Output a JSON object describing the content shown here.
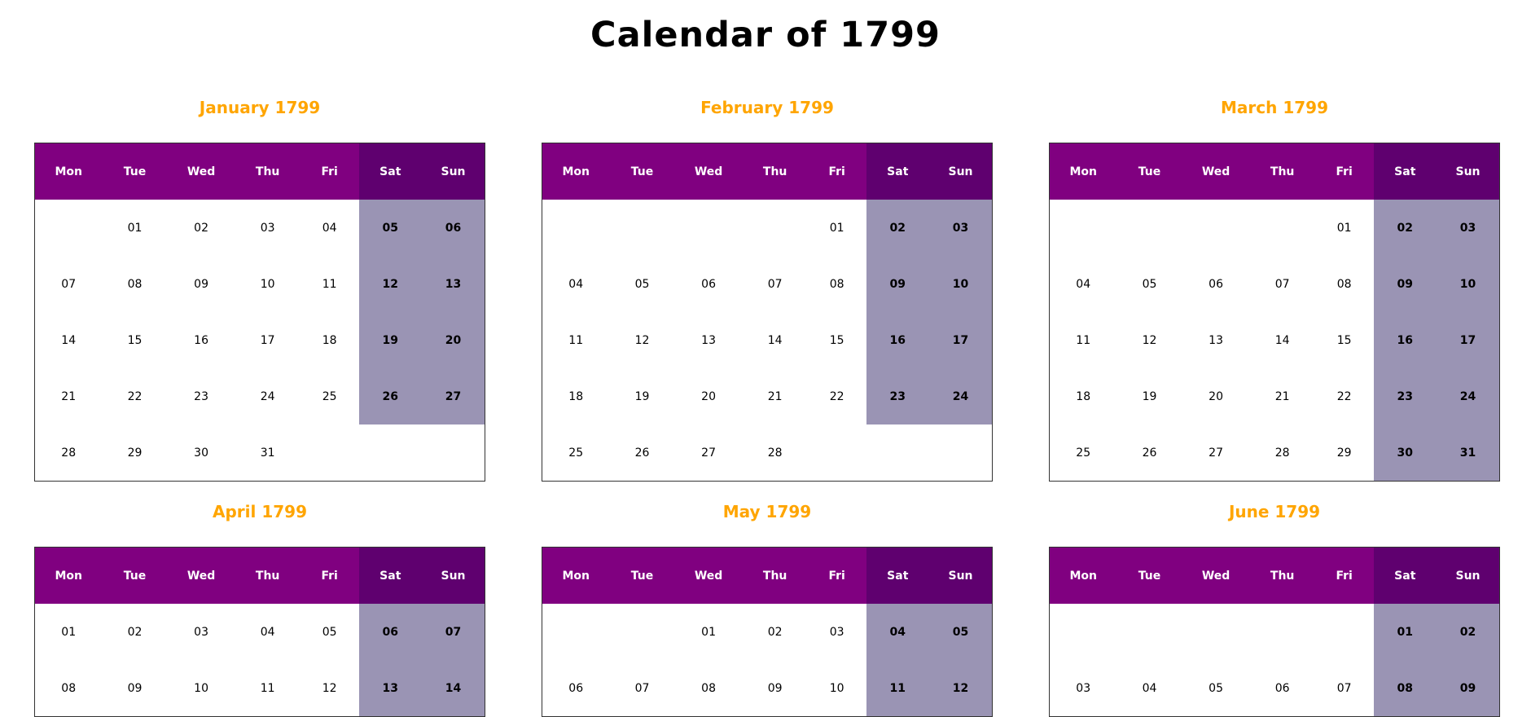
{
  "title": "Calendar of 1799",
  "colors": {
    "month_title": "#ffa500",
    "header_weekday": "#800080",
    "header_weekend": "#5f006f",
    "weekend_cell": "#9a94b4"
  },
  "weekdays": [
    "Mon",
    "Tue",
    "Wed",
    "Thu",
    "Fri",
    "Sat",
    "Sun"
  ],
  "months": [
    {
      "title": "January 1799",
      "weeks": [
        [
          "",
          "01",
          "02",
          "03",
          "04",
          "05",
          "06"
        ],
        [
          "07",
          "08",
          "09",
          "10",
          "11",
          "12",
          "13"
        ],
        [
          "14",
          "15",
          "16",
          "17",
          "18",
          "19",
          "20"
        ],
        [
          "21",
          "22",
          "23",
          "24",
          "25",
          "26",
          "27"
        ],
        [
          "28",
          "29",
          "30",
          "31",
          "",
          "",
          ""
        ]
      ]
    },
    {
      "title": "February 1799",
      "weeks": [
        [
          "",
          "",
          "",
          "",
          "01",
          "02",
          "03"
        ],
        [
          "04",
          "05",
          "06",
          "07",
          "08",
          "09",
          "10"
        ],
        [
          "11",
          "12",
          "13",
          "14",
          "15",
          "16",
          "17"
        ],
        [
          "18",
          "19",
          "20",
          "21",
          "22",
          "23",
          "24"
        ],
        [
          "25",
          "26",
          "27",
          "28",
          "",
          "",
          ""
        ]
      ]
    },
    {
      "title": "March 1799",
      "weeks": [
        [
          "",
          "",
          "",
          "",
          "01",
          "02",
          "03"
        ],
        [
          "04",
          "05",
          "06",
          "07",
          "08",
          "09",
          "10"
        ],
        [
          "11",
          "12",
          "13",
          "14",
          "15",
          "16",
          "17"
        ],
        [
          "18",
          "19",
          "20",
          "21",
          "22",
          "23",
          "24"
        ],
        [
          "25",
          "26",
          "27",
          "28",
          "29",
          "30",
          "31"
        ]
      ]
    },
    {
      "title": "April 1799",
      "weeks": [
        [
          "01",
          "02",
          "03",
          "04",
          "05",
          "06",
          "07"
        ],
        [
          "08",
          "09",
          "10",
          "11",
          "12",
          "13",
          "14"
        ]
      ]
    },
    {
      "title": "May 1799",
      "weeks": [
        [
          "",
          "",
          "01",
          "02",
          "03",
          "04",
          "05"
        ],
        [
          "06",
          "07",
          "08",
          "09",
          "10",
          "11",
          "12"
        ]
      ]
    },
    {
      "title": "June 1799",
      "weeks": [
        [
          "",
          "",
          "",
          "",
          "",
          "01",
          "02"
        ],
        [
          "03",
          "04",
          "05",
          "06",
          "07",
          "08",
          "09"
        ]
      ]
    }
  ]
}
